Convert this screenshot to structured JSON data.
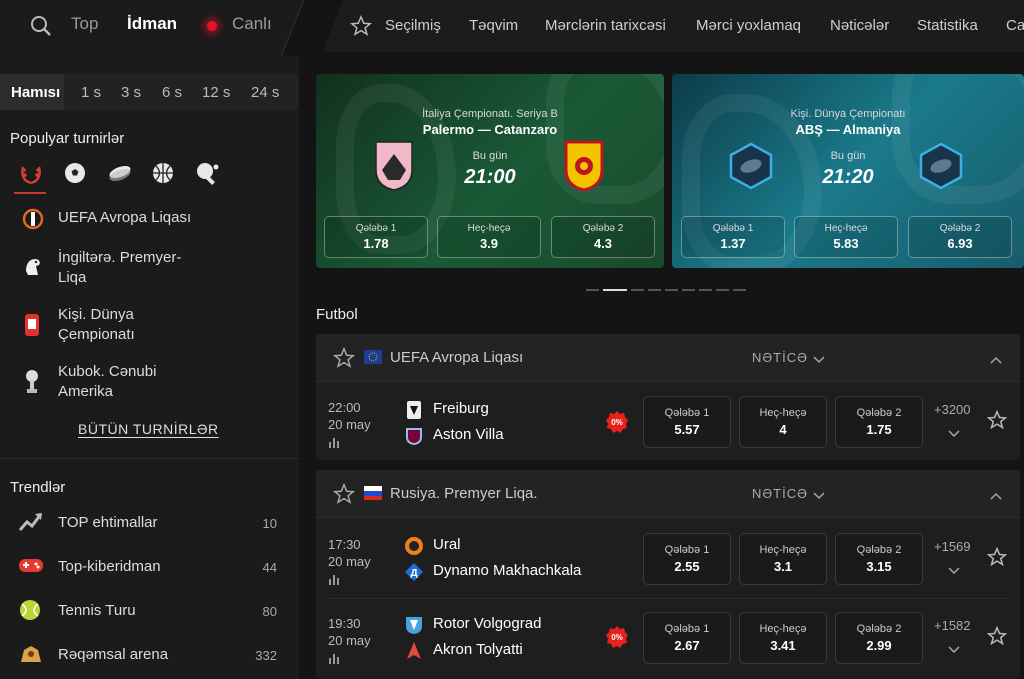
{
  "topnav": {
    "left": {
      "top": "Top",
      "sport": "İdman",
      "live": "Canlı"
    },
    "items": [
      "Seçilmiş",
      "Təqvim",
      "Mərclərin tarixcəsi",
      "Mərci yoxlamaq",
      "Nəticələr",
      "Statistika",
      "Ca"
    ]
  },
  "sidebar": {
    "timeframes": [
      "Hamısı",
      "1 s",
      "3 s",
      "6 s",
      "12 s",
      "24 s"
    ],
    "popular_title": "Populyar turnirlər",
    "sport_icons": [
      "laurel-icon",
      "soccer-ball-icon",
      "hockey-puck-icon",
      "basketball-icon",
      "table-tennis-icon"
    ],
    "tournaments": [
      {
        "name": "UEFA Avropa Liqası",
        "icon": "europa-league-icon"
      },
      {
        "name": "İngiltərə. Premyer-Liqa",
        "icon": "premier-league-icon"
      },
      {
        "name": "Kişi. Dünya Çempionatı",
        "icon": "world-championship-icon"
      },
      {
        "name": "Kubok. Cənubi Amerika",
        "icon": "trophy-icon"
      }
    ],
    "all_tournaments": "BÜTÜN TURNİRLƏR",
    "trends_title": "Trendlər",
    "trends": [
      {
        "name": "TOP ehtimallar",
        "count": "10",
        "icon": "trend-up-icon"
      },
      {
        "name": "Top-kiberidman",
        "count": "44",
        "icon": "gamepad-icon"
      },
      {
        "name": "Tennis Turu",
        "count": "80",
        "icon": "tennis-ball-icon"
      },
      {
        "name": "Rəqəmsal arena",
        "count": "332",
        "icon": "arena-icon"
      }
    ]
  },
  "banners": [
    {
      "competition": "İtaliya Çempionatı. Seriya B",
      "home": "Palermo",
      "away": "Catanzaro",
      "day": "Bu gün",
      "time": "21:00",
      "odds": [
        {
          "label": "Qələbə 1",
          "value": "1.78"
        },
        {
          "label": "Heç-heçə",
          "value": "3.9"
        },
        {
          "label": "Qələbə 2",
          "value": "4.3"
        }
      ]
    },
    {
      "competition": "Kişi. Dünya Çempionatı",
      "home": "ABŞ",
      "away": "Almaniya",
      "day": "Bu gün",
      "time": "21:20",
      "odds": [
        {
          "label": "Qələbə 1",
          "value": "1.37"
        },
        {
          "label": "Heç-heçə",
          "value": "5.83"
        },
        {
          "label": "Qələbə 2",
          "value": "6.93"
        }
      ]
    }
  ],
  "football": {
    "title": "Futbol",
    "leagues": [
      {
        "name": "UEFA Avropa Liqası",
        "result_label": "NƏTİCƏ",
        "events": [
          {
            "time": "22:00",
            "date": "20 may",
            "home": "Freiburg",
            "away": "Aston Villa",
            "promo": "0%",
            "odds": [
              {
                "label": "Qələbə 1",
                "value": "5.57"
              },
              {
                "label": "Heç-heçə",
                "value": "4"
              },
              {
                "label": "Qələbə 2",
                "value": "1.75"
              }
            ],
            "more": "+3200"
          }
        ]
      },
      {
        "name": "Rusiya. Premyer Liqa.",
        "result_label": "NƏTİCƏ",
        "events": [
          {
            "time": "17:30",
            "date": "20 may",
            "home": "Ural",
            "away": "Dynamo Makhachkala",
            "promo": "",
            "odds": [
              {
                "label": "Qələbə 1",
                "value": "2.55"
              },
              {
                "label": "Heç-heçə",
                "value": "3.1"
              },
              {
                "label": "Qələbə 2",
                "value": "3.15"
              }
            ],
            "more": "+1569"
          },
          {
            "time": "19:30",
            "date": "20 may",
            "home": "Rotor Volgograd",
            "away": "Akron Tolyatti",
            "promo": "0%",
            "odds": [
              {
                "label": "Qələbə 1",
                "value": "2.67"
              },
              {
                "label": "Heç-heçə",
                "value": "3.41"
              },
              {
                "label": "Qələbə 2",
                "value": "2.99"
              }
            ],
            "more": "+1582"
          }
        ]
      }
    ]
  },
  "colors": {
    "accent_red": "#e0142b",
    "background": "#141414",
    "panel": "#1b1b1b"
  }
}
